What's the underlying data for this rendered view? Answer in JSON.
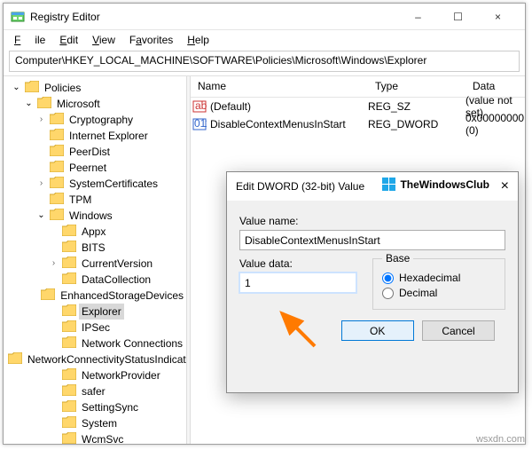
{
  "window": {
    "title": "Registry Editor",
    "min": "–",
    "max": "☐",
    "close": "×"
  },
  "menu": {
    "file": "File",
    "edit": "Edit",
    "view": "View",
    "favorites": "Favorites",
    "help": "Help"
  },
  "address": "Computer\\HKEY_LOCAL_MACHINE\\SOFTWARE\\Policies\\Microsoft\\Windows\\Explorer",
  "tree": {
    "nodes": [
      {
        "ind": 6,
        "chev": "v",
        "label": "Policies",
        "sel": false
      },
      {
        "ind": 20,
        "chev": "v",
        "label": "Microsoft",
        "sel": false
      },
      {
        "ind": 34,
        "chev": ">",
        "label": "Cryptography",
        "sel": false
      },
      {
        "ind": 34,
        "chev": "",
        "label": "Internet Explorer",
        "sel": false
      },
      {
        "ind": 34,
        "chev": "",
        "label": "PeerDist",
        "sel": false
      },
      {
        "ind": 34,
        "chev": "",
        "label": "Peernet",
        "sel": false
      },
      {
        "ind": 34,
        "chev": ">",
        "label": "SystemCertificates",
        "sel": false
      },
      {
        "ind": 34,
        "chev": "",
        "label": "TPM",
        "sel": false
      },
      {
        "ind": 34,
        "chev": "v",
        "label": "Windows",
        "sel": false
      },
      {
        "ind": 48,
        "chev": "",
        "label": "Appx",
        "sel": false
      },
      {
        "ind": 48,
        "chev": "",
        "label": "BITS",
        "sel": false
      },
      {
        "ind": 48,
        "chev": ">",
        "label": "CurrentVersion",
        "sel": false
      },
      {
        "ind": 48,
        "chev": "",
        "label": "DataCollection",
        "sel": false
      },
      {
        "ind": 48,
        "chev": "",
        "label": "EnhancedStorageDevices",
        "sel": false
      },
      {
        "ind": 48,
        "chev": "",
        "label": "Explorer",
        "sel": true
      },
      {
        "ind": 48,
        "chev": "",
        "label": "IPSec",
        "sel": false
      },
      {
        "ind": 48,
        "chev": "",
        "label": "Network Connections",
        "sel": false
      },
      {
        "ind": 48,
        "chev": "",
        "label": "NetworkConnectivityStatusIndicator",
        "sel": false
      },
      {
        "ind": 48,
        "chev": "",
        "label": "NetworkProvider",
        "sel": false
      },
      {
        "ind": 48,
        "chev": "",
        "label": "safer",
        "sel": false
      },
      {
        "ind": 48,
        "chev": "",
        "label": "SettingSync",
        "sel": false
      },
      {
        "ind": 48,
        "chev": "",
        "label": "System",
        "sel": false
      },
      {
        "ind": 48,
        "chev": "",
        "label": "WcmSvc",
        "sel": false
      }
    ]
  },
  "list": {
    "headers": {
      "name": "Name",
      "type": "Type",
      "data": "Data"
    },
    "rows": [
      {
        "icon": "sz",
        "name": "(Default)",
        "type": "REG_SZ",
        "data": "(value not set)"
      },
      {
        "icon": "dw",
        "name": "DisableContextMenusInStart",
        "type": "REG_DWORD",
        "data": "0x00000000 (0)"
      }
    ]
  },
  "dialog": {
    "title": "Edit DWORD (32-bit) Value",
    "close": "×",
    "brand": "TheWindowsClub",
    "valuename_label": "Value name:",
    "valuename": "DisableContextMenusInStart",
    "valuedata_label": "Value data:",
    "valuedata": "1",
    "base_label": "Base",
    "hex": "Hexadecimal",
    "dec": "Decimal",
    "ok": "OK",
    "cancel": "Cancel"
  },
  "watermark": "wsxdn.com"
}
